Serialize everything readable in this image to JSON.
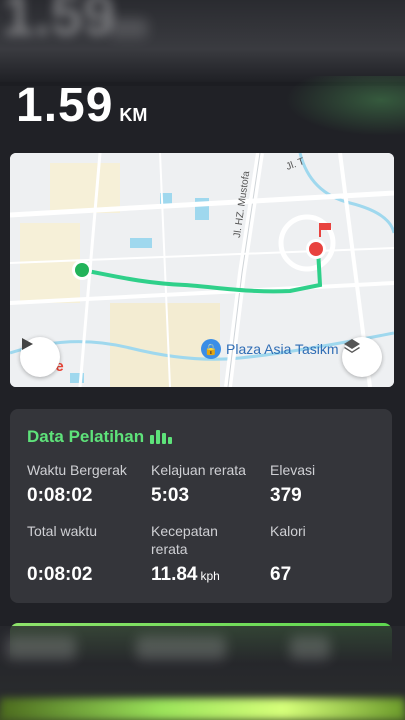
{
  "summary": {
    "distance_value": "1.59",
    "distance_unit": "KM"
  },
  "map": {
    "poi_label": "Plaza Asia Tasikm",
    "road_label": "Jl. HZ. Mustofa",
    "road_label_2": "Jl. T",
    "google_text": "gle",
    "play_icon": "play-icon",
    "layers_icon": "layers-icon",
    "route_color": "#2fd08a",
    "start_color": "#22b35a",
    "end_color": "#e8433f"
  },
  "training": {
    "title": "Data Pelatihan",
    "stats": [
      {
        "label": "Waktu Bergerak",
        "value": "0:08:02",
        "unit": ""
      },
      {
        "label": "Kelajuan rerata",
        "value": "5:03",
        "unit": ""
      },
      {
        "label": "Elevasi",
        "value": "379",
        "unit": ""
      },
      {
        "label": "Total waktu",
        "value": "0:08:02",
        "unit": ""
      },
      {
        "label": "Kecepatan rerata",
        "value": "11.84",
        "unit": "kph"
      },
      {
        "label": "Kalori",
        "value": "67",
        "unit": ""
      }
    ]
  },
  "colors": {
    "accent": "#5ee27a",
    "card_bg": "#34353a",
    "page_bg": "#202126"
  }
}
